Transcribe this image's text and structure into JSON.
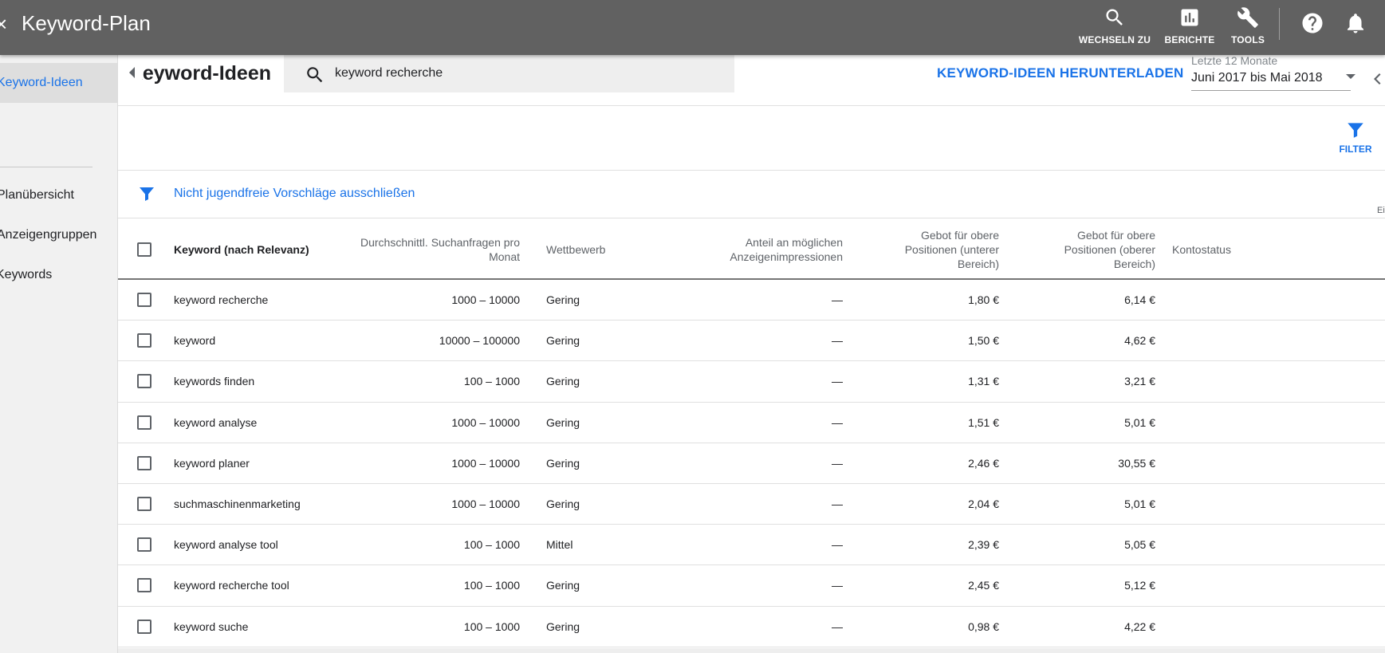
{
  "app": {
    "title": "Keyword-Plan",
    "close_icon": "close-icon"
  },
  "top_actions": [
    {
      "label": "WECHSELN ZU",
      "icon": "search-icon"
    },
    {
      "label": "BERICHTE",
      "icon": "bar-chart-icon"
    },
    {
      "label": "TOOLS",
      "icon": "wrench-icon"
    }
  ],
  "top_icons": [
    "help-icon",
    "bell-icon"
  ],
  "sidebar": {
    "items": [
      {
        "label": "Keyword-Ideen",
        "active": true
      },
      {
        "label": "Planübersicht",
        "active": false
      },
      {
        "label": "Anzeigengruppen",
        "active": false
      },
      {
        "label": "Keywords",
        "active": false
      }
    ]
  },
  "toolbar": {
    "page_title": "Keyword-Ideen",
    "search_value": "keyword recherche",
    "download_label": "KEYWORD-IDEEN HERUNTERLADEN",
    "date_label": "Letzte 12 Monate",
    "date_value": "Juni 2017 bis Mai 2018"
  },
  "filter": {
    "button_label": "FILTER",
    "chip_text": "Nicht jugendfreie Vorschläge ausschließen",
    "edge_text": "Ei"
  },
  "table": {
    "headers": {
      "keyword": "Keyword (nach Relevanz)",
      "volume_1": "Durchschnittl. Suchanfragen pro",
      "volume_2": "Monat",
      "competition": "Wettbewerb",
      "share_1": "Anteil an möglichen",
      "share_2": "Anzeigenimpressionen",
      "low_1": "Gebot für obere",
      "low_2": "Positionen (unterer",
      "low_3": "Bereich)",
      "high_1": "Gebot für obere",
      "high_2": "Positionen (oberer",
      "high_3": "Bereich)",
      "status": "Kontostatus"
    },
    "rows": [
      {
        "keyword": "keyword recherche",
        "volume": "1000 – 10000",
        "competition": "Gering",
        "share": "—",
        "low": "1,80 €",
        "high": "6,14 €"
      },
      {
        "keyword": "keyword",
        "volume": "10000 – 100000",
        "competition": "Gering",
        "share": "—",
        "low": "1,50 €",
        "high": "4,62 €"
      },
      {
        "keyword": "keywords finden",
        "volume": "100 – 1000",
        "competition": "Gering",
        "share": "—",
        "low": "1,31 €",
        "high": "3,21 €"
      },
      {
        "keyword": "keyword analyse",
        "volume": "1000 – 10000",
        "competition": "Gering",
        "share": "—",
        "low": "1,51 €",
        "high": "5,01 €"
      },
      {
        "keyword": "keyword planer",
        "volume": "1000 – 10000",
        "competition": "Gering",
        "share": "—",
        "low": "2,46 €",
        "high": "30,55 €"
      },
      {
        "keyword": "suchmaschinenmarketing",
        "volume": "1000 – 10000",
        "competition": "Gering",
        "share": "—",
        "low": "2,04 €",
        "high": "5,01 €"
      },
      {
        "keyword": "keyword analyse tool",
        "volume": "100 – 1000",
        "competition": "Mittel",
        "share": "—",
        "low": "2,39 €",
        "high": "5,05 €"
      },
      {
        "keyword": "keyword recherche tool",
        "volume": "100 – 1000",
        "competition": "Gering",
        "share": "—",
        "low": "2,45 €",
        "high": "5,12 €"
      },
      {
        "keyword": "keyword suche",
        "volume": "100 – 1000",
        "competition": "Gering",
        "share": "—",
        "low": "0,98 €",
        "high": "4,22 €"
      }
    ]
  },
  "colors": {
    "topbar": "#616161",
    "accent": "#1a73e8",
    "sidebar": "#f1f1f1"
  }
}
